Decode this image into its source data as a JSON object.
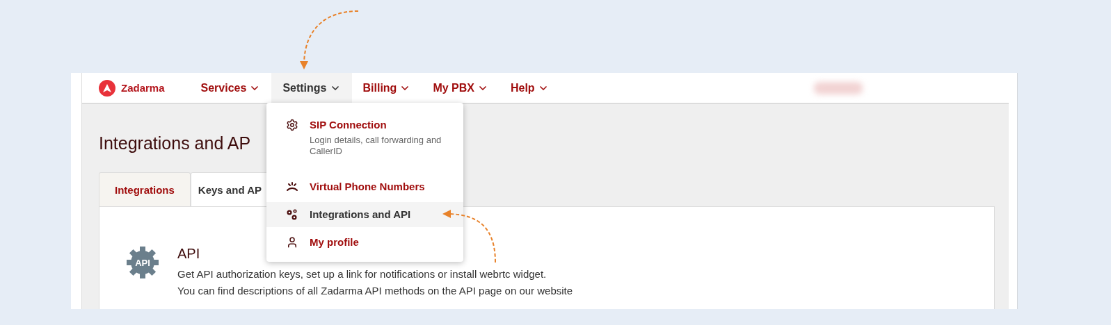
{
  "brand": {
    "name": "Zadarma"
  },
  "nav": [
    {
      "label": "Services",
      "selected": false
    },
    {
      "label": "Settings",
      "selected": true
    },
    {
      "label": "Billing",
      "selected": false
    },
    {
      "label": "My PBX",
      "selected": false
    },
    {
      "label": "Help",
      "selected": false
    }
  ],
  "page_title": "Integrations and AP",
  "tabs": [
    {
      "label": "Integrations",
      "selected": false
    },
    {
      "label": "Keys and AP",
      "selected": true
    }
  ],
  "card": {
    "icon_label": "API",
    "title": "API",
    "lines": [
      "Get API authorization keys, set up a link for notifications or install webrtc widget.",
      "You can find descriptions of all Zadarma API methods on the API page on our website"
    ]
  },
  "menu": [
    {
      "kind": "gear",
      "title": "SIP Connection",
      "description": "Login details, call forwarding and CallerID",
      "selected": false
    },
    {
      "kind": "phone",
      "title": "Virtual Phone Numbers",
      "selected": false
    },
    {
      "kind": "cogs",
      "title": "Integrations and API",
      "selected": true
    },
    {
      "kind": "person",
      "title": "My profile",
      "selected": false
    }
  ]
}
